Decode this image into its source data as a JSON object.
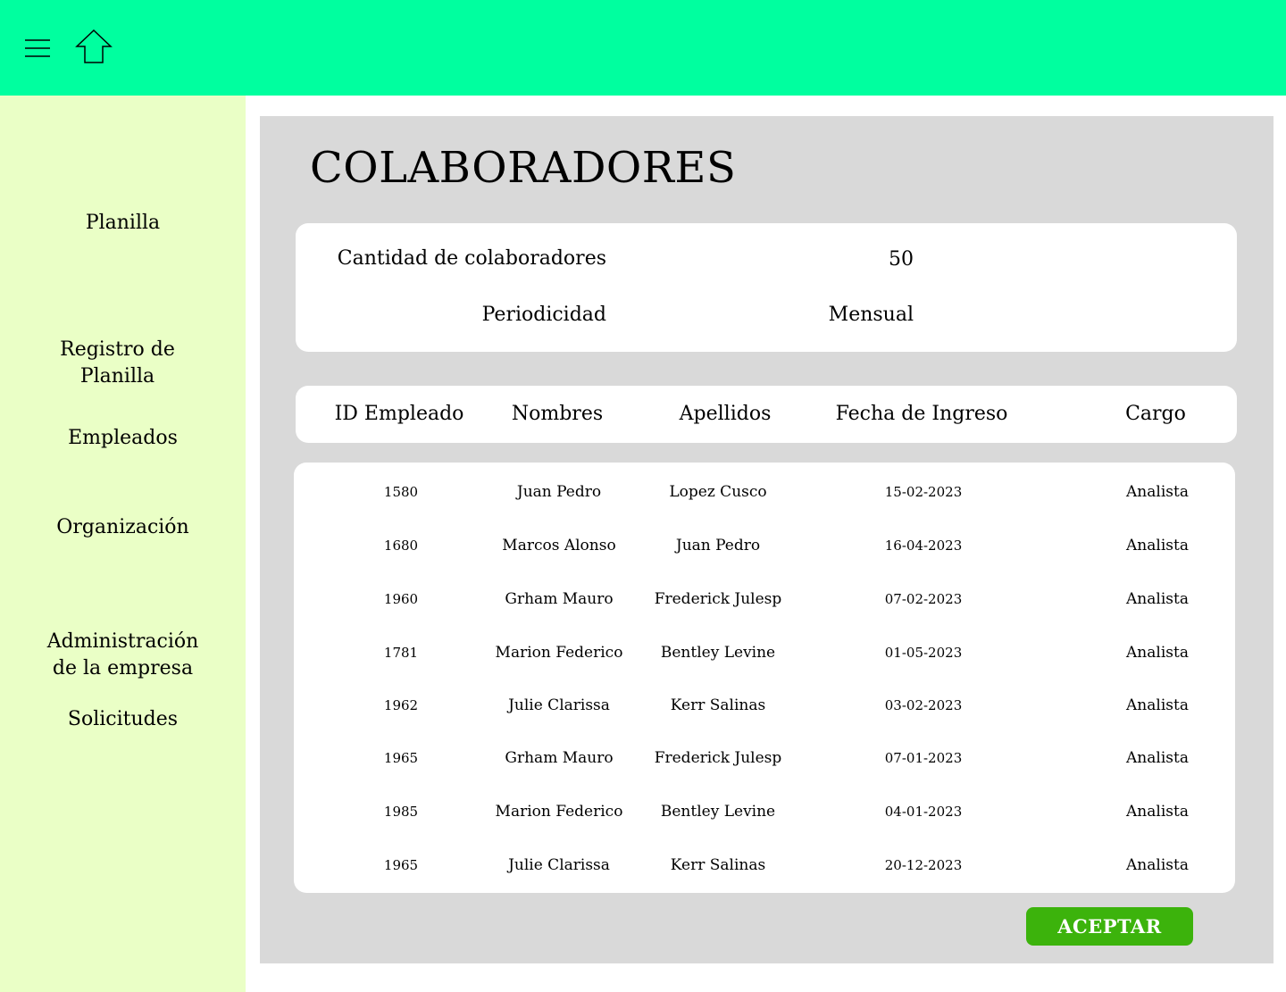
{
  "colors": {
    "topbar": "#00ff9f",
    "sidebar": "#eaffc6",
    "main_panel": "#d9d9d9",
    "accept_button": "#3cb30c"
  },
  "topbar": {
    "menu_icon": "hamburger-menu-icon",
    "home_icon": "home-arrow-icon"
  },
  "sidebar": {
    "items": [
      {
        "label": "Planilla"
      },
      {
        "label": "Registro de\nPlanilla"
      },
      {
        "label": "Empleados"
      },
      {
        "label": "Organización"
      },
      {
        "label": "Administración\nde la empresa"
      },
      {
        "label": "Solicitudes"
      }
    ]
  },
  "main": {
    "title": "COLABORADORES",
    "summary": {
      "count_label": "Cantidad de colaboradores",
      "count_value": "50",
      "period_label": "Periodicidad",
      "period_value": "Mensual"
    },
    "table": {
      "headers": [
        "ID Empleado",
        "Nombres",
        "Apellidos",
        "Fecha de Ingreso",
        "Cargo"
      ],
      "rows": [
        [
          "1580",
          "Juan Pedro",
          "Lopez Cusco",
          "15-02-2023",
          "Analista"
        ],
        [
          "1680",
          "Marcos Alonso",
          "Juan Pedro",
          "16-04-2023",
          "Analista"
        ],
        [
          "1960",
          "Grham Mauro",
          "Frederick Julesp",
          "07-02-2023",
          "Analista"
        ],
        [
          "1781",
          "Marion Federico",
          "Bentley Levine",
          "01-05-2023",
          "Analista"
        ],
        [
          "1962",
          "Julie Clarissa",
          "Kerr Salinas",
          "03-02-2023",
          "Analista"
        ],
        [
          "1965",
          "Grham Mauro",
          "Frederick Julesp",
          "07-01-2023",
          "Analista"
        ],
        [
          "1985",
          "Marion Federico",
          "Bentley Levine",
          "04-01-2023",
          "Analista"
        ],
        [
          "1965",
          "Julie Clarissa",
          "Kerr Salinas",
          "20-12-2023",
          "Analista"
        ]
      ]
    },
    "accept_label": "ACEPTAR"
  }
}
